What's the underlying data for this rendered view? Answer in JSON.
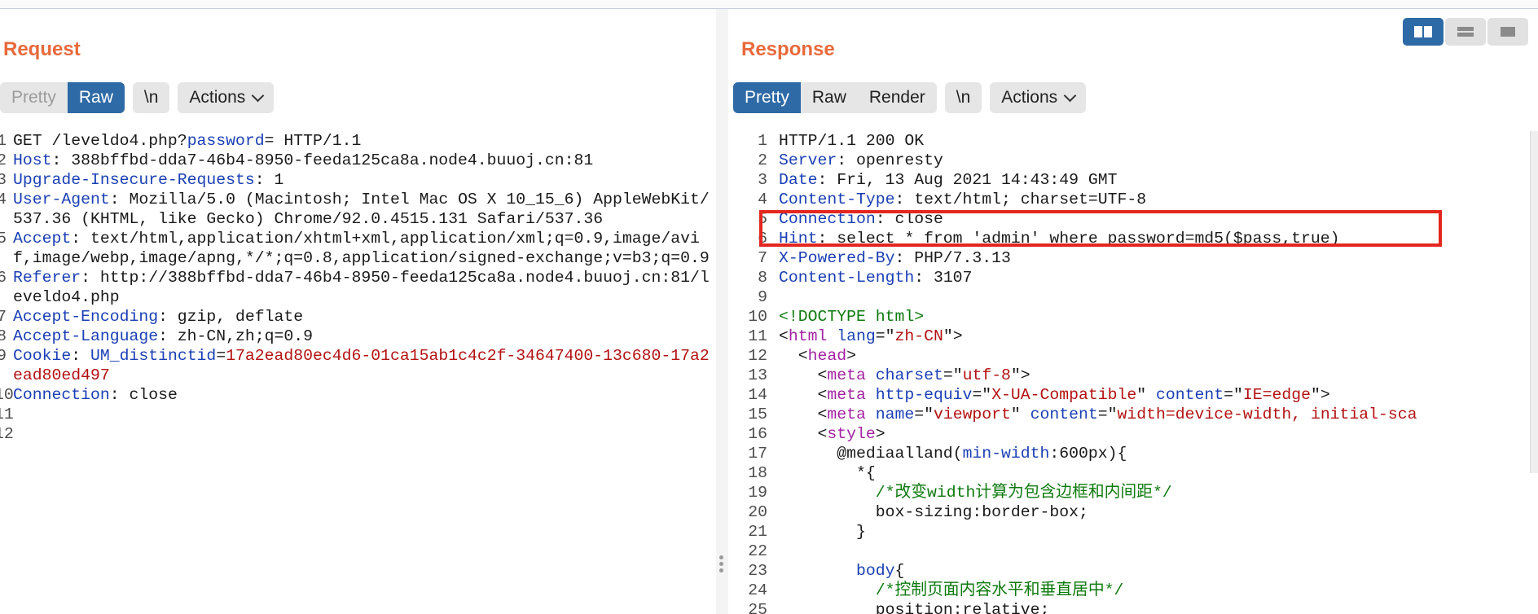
{
  "request": {
    "title": "Request",
    "tabs": [
      "Pretty",
      "Raw"
    ],
    "newline_button": "\\n",
    "actions_label": "Actions",
    "lines": [
      {
        "num": "1",
        "segs": [
          [
            "pl",
            "GET /leveldo4.php?"
          ],
          [
            "ck",
            "password"
          ],
          [
            "pl",
            "= HTTP/1.1"
          ]
        ]
      },
      {
        "num": "2",
        "segs": [
          [
            "hk",
            "Host"
          ],
          [
            "hv",
            ": 388bffbd-dda7-46b4-8950-feeda125ca8a.node4.buuoj.cn:81"
          ]
        ]
      },
      {
        "num": "3",
        "segs": [
          [
            "hk",
            "Upgrade-Insecure-Requests"
          ],
          [
            "hv",
            ": 1"
          ]
        ]
      },
      {
        "num": "4",
        "segs": [
          [
            "hk",
            "User-Agent"
          ],
          [
            "hv",
            ": Mozilla/5.0 (Macintosh; Intel Mac OS X 10_15_6) AppleWebKit/537.36 (KHTML, like Gecko) Chrome/92.0.4515.131 Safari/537.36"
          ]
        ]
      },
      {
        "num": "5",
        "segs": [
          [
            "hk",
            "Accept"
          ],
          [
            "hv",
            ": text/html,application/xhtml+xml,application/xml;q=0.9,image/avif,image/webp,image/apng,*/*;q=0.8,application/signed-exchange;v=b3;q=0.9"
          ]
        ]
      },
      {
        "num": "6",
        "segs": [
          [
            "hk",
            "Referer"
          ],
          [
            "hv",
            ": http://388bffbd-dda7-46b4-8950-feeda125ca8a.node4.buuoj.cn:81/leveldo4.php"
          ]
        ]
      },
      {
        "num": "7",
        "segs": [
          [
            "hk",
            "Accept-Encoding"
          ],
          [
            "hv",
            ": gzip, deflate"
          ]
        ]
      },
      {
        "num": "8",
        "segs": [
          [
            "hk",
            "Accept-Language"
          ],
          [
            "hv",
            ": zh-CN,zh;q=0.9"
          ]
        ]
      },
      {
        "num": "9",
        "segs": [
          [
            "hk",
            "Cookie"
          ],
          [
            "hv",
            ": "
          ],
          [
            "ck",
            "UM_distinctid"
          ],
          [
            "hv",
            "="
          ],
          [
            "cv",
            "17a2ead80ec4d6-01ca15ab1c4c2f-34647400-13c680-17a2ead80ed497"
          ]
        ]
      },
      {
        "num": "10",
        "segs": [
          [
            "hk",
            "Connection"
          ],
          [
            "hv",
            ": close"
          ]
        ]
      },
      {
        "num": "11",
        "segs": []
      },
      {
        "num": "12",
        "segs": []
      }
    ]
  },
  "response": {
    "title": "Response",
    "tabs": [
      "Pretty",
      "Raw",
      "Render"
    ],
    "newline_button": "\\n",
    "actions_label": "Actions",
    "lines": [
      {
        "num": "1",
        "segs": [
          [
            "pl",
            "HTTP/1.1 200 OK"
          ]
        ]
      },
      {
        "num": "2",
        "segs": [
          [
            "hk",
            "Server"
          ],
          [
            "hv",
            ": openresty"
          ]
        ]
      },
      {
        "num": "3",
        "segs": [
          [
            "hk",
            "Date"
          ],
          [
            "hv",
            ": Fri, 13 Aug 2021 14:43:49 GMT"
          ]
        ]
      },
      {
        "num": "4",
        "segs": [
          [
            "hk",
            "Content-Type"
          ],
          [
            "hv",
            ": text/html; charset=UTF-8"
          ]
        ]
      },
      {
        "num": "5",
        "segs": [
          [
            "hk",
            "Connection"
          ],
          [
            "hv",
            ": close"
          ]
        ]
      },
      {
        "num": "6",
        "segs": [
          [
            "hk",
            "Hint"
          ],
          [
            "hv",
            ": select * from 'admin' where password=md5($pass,true)"
          ]
        ]
      },
      {
        "num": "7",
        "segs": [
          [
            "hk",
            "X-Powered-By"
          ],
          [
            "hv",
            ": PHP/7.3.13"
          ]
        ]
      },
      {
        "num": "8",
        "segs": [
          [
            "hk",
            "Content-Length"
          ],
          [
            "hv",
            ": 3107"
          ]
        ]
      },
      {
        "num": "9",
        "segs": []
      },
      {
        "num": "10",
        "segs": [
          [
            "dt",
            "<!DOCTYPE html>"
          ]
        ]
      },
      {
        "num": "11",
        "segs": [
          [
            "pl",
            "<"
          ],
          [
            "tg",
            "html"
          ],
          [
            "pl",
            " "
          ],
          [
            "at",
            "lang"
          ],
          [
            "pl",
            "=\""
          ],
          [
            "av",
            "zh-CN"
          ],
          [
            "pl",
            "\">"
          ]
        ]
      },
      {
        "num": "12",
        "segs": [
          [
            "pl",
            "  <"
          ],
          [
            "tg",
            "head"
          ],
          [
            "pl",
            ">"
          ]
        ]
      },
      {
        "num": "13",
        "segs": [
          [
            "pl",
            "    <"
          ],
          [
            "tg",
            "meta"
          ],
          [
            "pl",
            " "
          ],
          [
            "at",
            "charset"
          ],
          [
            "pl",
            "=\""
          ],
          [
            "av",
            "utf-8"
          ],
          [
            "pl",
            "\">"
          ]
        ]
      },
      {
        "num": "14",
        "segs": [
          [
            "pl",
            "    <"
          ],
          [
            "tg",
            "meta"
          ],
          [
            "pl",
            " "
          ],
          [
            "at",
            "http-equiv"
          ],
          [
            "pl",
            "=\""
          ],
          [
            "av",
            "X-UA-Compatible"
          ],
          [
            "pl",
            "\" "
          ],
          [
            "at",
            "content"
          ],
          [
            "pl",
            "=\""
          ],
          [
            "av",
            "IE=edge"
          ],
          [
            "pl",
            "\">"
          ]
        ]
      },
      {
        "num": "15",
        "segs": [
          [
            "pl",
            "    <"
          ],
          [
            "tg",
            "meta"
          ],
          [
            "pl",
            " "
          ],
          [
            "at",
            "name"
          ],
          [
            "pl",
            "=\""
          ],
          [
            "av",
            "viewport"
          ],
          [
            "pl",
            "\" "
          ],
          [
            "at",
            "content"
          ],
          [
            "pl",
            "=\""
          ],
          [
            "av",
            "width=device-width, initial-sca"
          ]
        ]
      },
      {
        "num": "16",
        "segs": [
          [
            "pl",
            "    <"
          ],
          [
            "tg",
            "style"
          ],
          [
            "pl",
            ">"
          ]
        ]
      },
      {
        "num": "17",
        "segs": [
          [
            "pl",
            "      @mediaalland("
          ],
          [
            "at",
            "min-width"
          ],
          [
            "pl",
            ":600px){"
          ]
        ]
      },
      {
        "num": "18",
        "segs": [
          [
            "pl",
            "        *{"
          ]
        ]
      },
      {
        "num": "19",
        "segs": [
          [
            "cm",
            "          /*改变width计算为包含边框和内间距*/"
          ]
        ]
      },
      {
        "num": "20",
        "segs": [
          [
            "pl",
            "          box-sizing:border-box;"
          ]
        ]
      },
      {
        "num": "21",
        "segs": [
          [
            "pl",
            "        }"
          ]
        ]
      },
      {
        "num": "22",
        "segs": []
      },
      {
        "num": "23",
        "segs": [
          [
            "pl",
            "        "
          ],
          [
            "at",
            "body"
          ],
          [
            "pl",
            "{"
          ]
        ]
      },
      {
        "num": "24",
        "segs": [
          [
            "cm",
            "          /*控制页面内容水平和垂直居中*/"
          ]
        ]
      },
      {
        "num": "25",
        "segs": [
          [
            "pl",
            "          position:relative;"
          ]
        ]
      }
    ]
  },
  "colors": {
    "accent": "#e8693b",
    "selected": "#2e6aa6",
    "highlight_box": "#e3261f"
  },
  "view_toggle_icons": [
    "split-horizontal-icon",
    "split-vertical-icon",
    "single-pane-icon"
  ]
}
